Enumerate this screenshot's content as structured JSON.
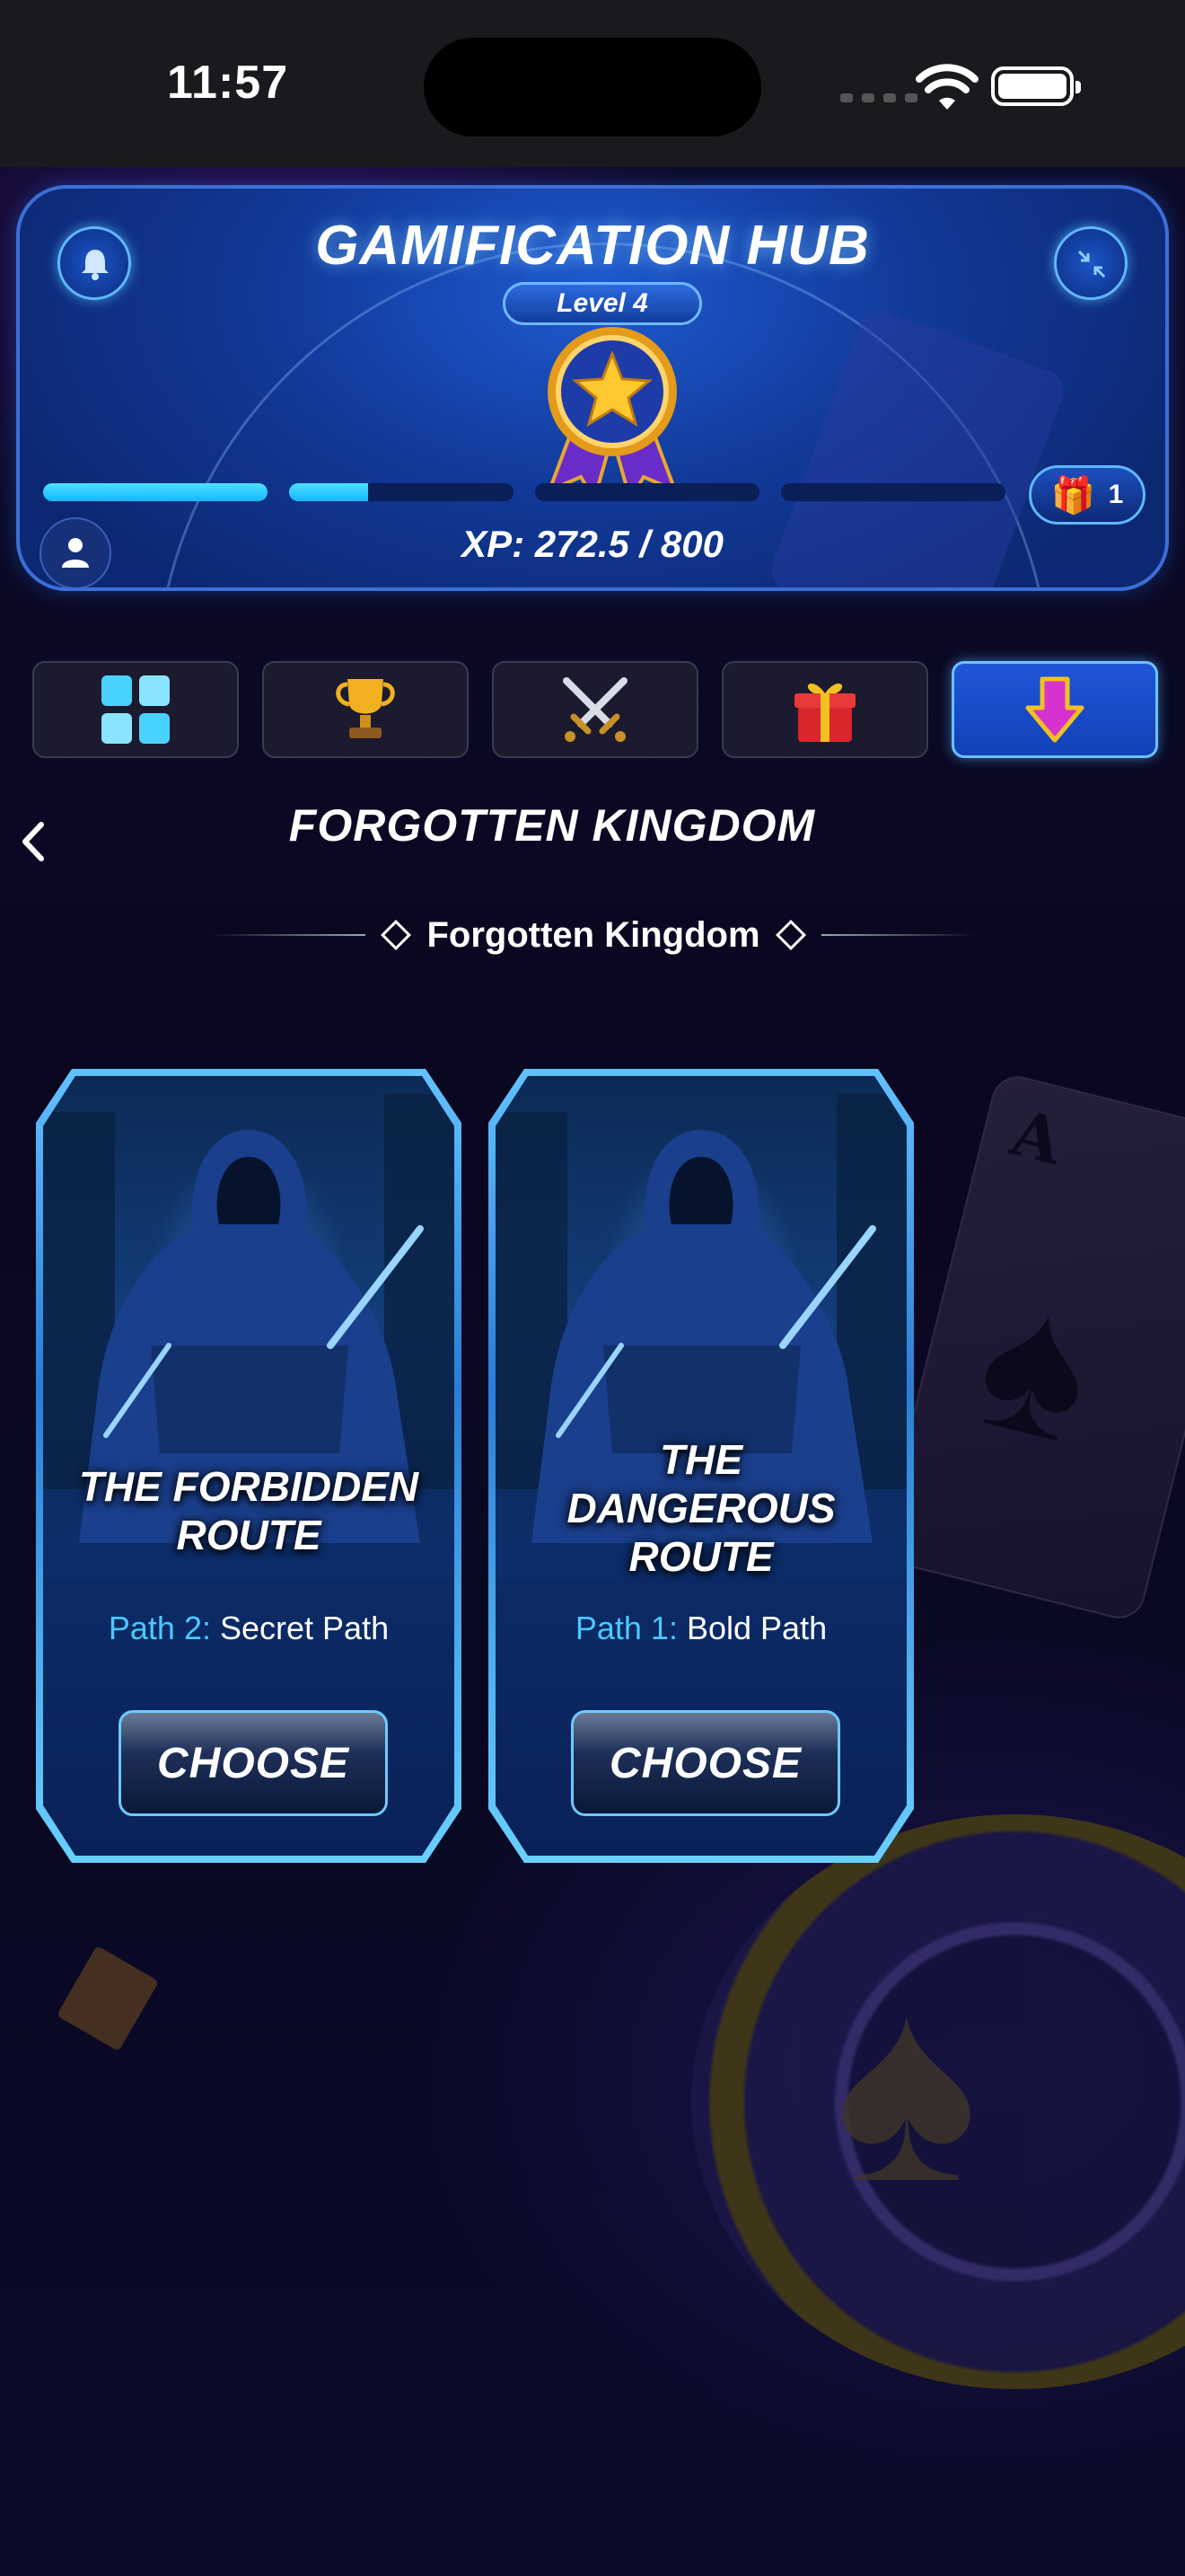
{
  "status": {
    "time": "11:57"
  },
  "hub": {
    "title": "GAMIFICATION HUB",
    "level": "Level 4",
    "xp": "XP: 272.5 / 800",
    "gift_count": "1",
    "progress_segments": [
      1.0,
      0.35,
      0.0,
      0.0
    ]
  },
  "tabs": [
    {
      "name": "dashboard",
      "icon": "grid-icon",
      "active": false
    },
    {
      "name": "trophies",
      "icon": "trophy-icon",
      "active": false
    },
    {
      "name": "battles",
      "icon": "crossed-swords-icon",
      "active": false
    },
    {
      "name": "rewards",
      "icon": "gift-icon",
      "active": false
    },
    {
      "name": "path",
      "icon": "down-arrow-icon",
      "active": true
    }
  ],
  "page": {
    "title": "FORGOTTEN KINGDOM",
    "subtitle": "Forgotten Kingdom"
  },
  "cards": [
    {
      "title": "THE FORBIDDEN ROUTE",
      "path_key": "Path 2:",
      "path_value": "Secret Path",
      "button": "CHOOSE"
    },
    {
      "title": "THE DANGEROUS ROUTE",
      "path_key": "Path 1:",
      "path_value": "Bold Path",
      "button": "CHOOSE"
    }
  ],
  "colors": {
    "accent": "#14b6ff",
    "panel": "#123a9a",
    "background": "#0a0820"
  }
}
